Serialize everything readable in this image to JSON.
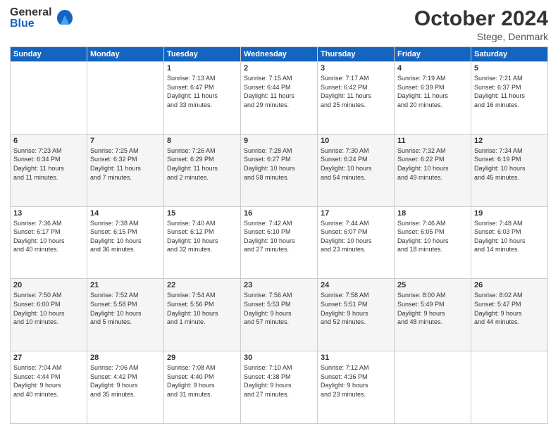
{
  "header": {
    "logo_general": "General",
    "logo_blue": "Blue",
    "month": "October 2024",
    "location": "Stege, Denmark"
  },
  "days_of_week": [
    "Sunday",
    "Monday",
    "Tuesday",
    "Wednesday",
    "Thursday",
    "Friday",
    "Saturday"
  ],
  "weeks": [
    [
      {
        "day": "",
        "info": ""
      },
      {
        "day": "",
        "info": ""
      },
      {
        "day": "1",
        "info": "Sunrise: 7:13 AM\nSunset: 6:47 PM\nDaylight: 11 hours\nand 33 minutes."
      },
      {
        "day": "2",
        "info": "Sunrise: 7:15 AM\nSunset: 6:44 PM\nDaylight: 11 hours\nand 29 minutes."
      },
      {
        "day": "3",
        "info": "Sunrise: 7:17 AM\nSunset: 6:42 PM\nDaylight: 11 hours\nand 25 minutes."
      },
      {
        "day": "4",
        "info": "Sunrise: 7:19 AM\nSunset: 6:39 PM\nDaylight: 11 hours\nand 20 minutes."
      },
      {
        "day": "5",
        "info": "Sunrise: 7:21 AM\nSunset: 6:37 PM\nDaylight: 11 hours\nand 16 minutes."
      }
    ],
    [
      {
        "day": "6",
        "info": "Sunrise: 7:23 AM\nSunset: 6:34 PM\nDaylight: 11 hours\nand 11 minutes."
      },
      {
        "day": "7",
        "info": "Sunrise: 7:25 AM\nSunset: 6:32 PM\nDaylight: 11 hours\nand 7 minutes."
      },
      {
        "day": "8",
        "info": "Sunrise: 7:26 AM\nSunset: 6:29 PM\nDaylight: 11 hours\nand 2 minutes."
      },
      {
        "day": "9",
        "info": "Sunrise: 7:28 AM\nSunset: 6:27 PM\nDaylight: 10 hours\nand 58 minutes."
      },
      {
        "day": "10",
        "info": "Sunrise: 7:30 AM\nSunset: 6:24 PM\nDaylight: 10 hours\nand 54 minutes."
      },
      {
        "day": "11",
        "info": "Sunrise: 7:32 AM\nSunset: 6:22 PM\nDaylight: 10 hours\nand 49 minutes."
      },
      {
        "day": "12",
        "info": "Sunrise: 7:34 AM\nSunset: 6:19 PM\nDaylight: 10 hours\nand 45 minutes."
      }
    ],
    [
      {
        "day": "13",
        "info": "Sunrise: 7:36 AM\nSunset: 6:17 PM\nDaylight: 10 hours\nand 40 minutes."
      },
      {
        "day": "14",
        "info": "Sunrise: 7:38 AM\nSunset: 6:15 PM\nDaylight: 10 hours\nand 36 minutes."
      },
      {
        "day": "15",
        "info": "Sunrise: 7:40 AM\nSunset: 6:12 PM\nDaylight: 10 hours\nand 32 minutes."
      },
      {
        "day": "16",
        "info": "Sunrise: 7:42 AM\nSunset: 6:10 PM\nDaylight: 10 hours\nand 27 minutes."
      },
      {
        "day": "17",
        "info": "Sunrise: 7:44 AM\nSunset: 6:07 PM\nDaylight: 10 hours\nand 23 minutes."
      },
      {
        "day": "18",
        "info": "Sunrise: 7:46 AM\nSunset: 6:05 PM\nDaylight: 10 hours\nand 18 minutes."
      },
      {
        "day": "19",
        "info": "Sunrise: 7:48 AM\nSunset: 6:03 PM\nDaylight: 10 hours\nand 14 minutes."
      }
    ],
    [
      {
        "day": "20",
        "info": "Sunrise: 7:50 AM\nSunset: 6:00 PM\nDaylight: 10 hours\nand 10 minutes."
      },
      {
        "day": "21",
        "info": "Sunrise: 7:52 AM\nSunset: 5:58 PM\nDaylight: 10 hours\nand 5 minutes."
      },
      {
        "day": "22",
        "info": "Sunrise: 7:54 AM\nSunset: 5:56 PM\nDaylight: 10 hours\nand 1 minute."
      },
      {
        "day": "23",
        "info": "Sunrise: 7:56 AM\nSunset: 5:53 PM\nDaylight: 9 hours\nand 57 minutes."
      },
      {
        "day": "24",
        "info": "Sunrise: 7:58 AM\nSunset: 5:51 PM\nDaylight: 9 hours\nand 52 minutes."
      },
      {
        "day": "25",
        "info": "Sunrise: 8:00 AM\nSunset: 5:49 PM\nDaylight: 9 hours\nand 48 minutes."
      },
      {
        "day": "26",
        "info": "Sunrise: 8:02 AM\nSunset: 5:47 PM\nDaylight: 9 hours\nand 44 minutes."
      }
    ],
    [
      {
        "day": "27",
        "info": "Sunrise: 7:04 AM\nSunset: 4:44 PM\nDaylight: 9 hours\nand 40 minutes."
      },
      {
        "day": "28",
        "info": "Sunrise: 7:06 AM\nSunset: 4:42 PM\nDaylight: 9 hours\nand 35 minutes."
      },
      {
        "day": "29",
        "info": "Sunrise: 7:08 AM\nSunset: 4:40 PM\nDaylight: 9 hours\nand 31 minutes."
      },
      {
        "day": "30",
        "info": "Sunrise: 7:10 AM\nSunset: 4:38 PM\nDaylight: 9 hours\nand 27 minutes."
      },
      {
        "day": "31",
        "info": "Sunrise: 7:12 AM\nSunset: 4:36 PM\nDaylight: 9 hours\nand 23 minutes."
      },
      {
        "day": "",
        "info": ""
      },
      {
        "day": "",
        "info": ""
      }
    ]
  ]
}
